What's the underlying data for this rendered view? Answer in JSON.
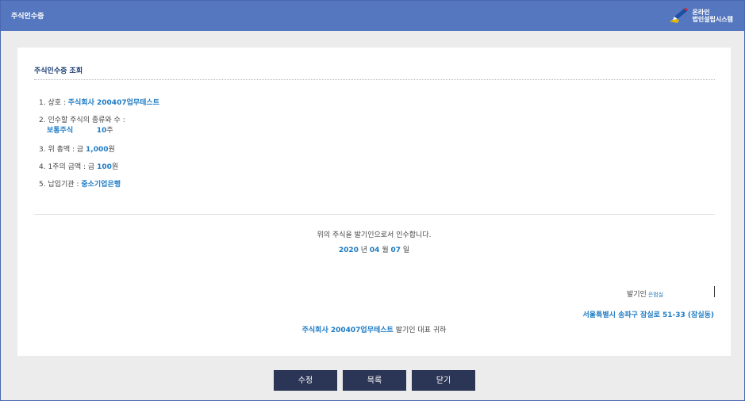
{
  "window": {
    "title": "주식인수증",
    "brand_line1": "온라인",
    "brand_line2": "법인설립시스템"
  },
  "section": {
    "title": "주식인수증 조회"
  },
  "items": {
    "company_label": "1. 상호 : ",
    "company_value": "주식회사 200407업무테스트",
    "stock_label": "2. 인수할 주식의 종류와 수 :",
    "stock_type": "보통주식",
    "stock_count": "10",
    "stock_unit": "주",
    "total_label": "3. 위 총액 : 금 ",
    "total_value": "1,000",
    "total_unit": "원",
    "par_label": "4. 1주의 금액 : 금 ",
    "par_value": "100",
    "par_unit": "원",
    "bank_label": "5. 납입기관 : ",
    "bank_value": "중소기업은행"
  },
  "statement": {
    "text": "위의 주식을 발기인으로서 인수합니다.",
    "year": "2020",
    "year_unit": " 년 ",
    "month": "04",
    "month_unit": " 월 ",
    "day": "07",
    "day_unit": " 일"
  },
  "issuer": {
    "label": "발기인",
    "name": "은범실",
    "address": "서울특별시 송파구 잠실로 51-33 (잠실동)"
  },
  "recipient": {
    "company": "주식회사 200407업무테스트",
    "suffix": " 발기인 대표 귀하"
  },
  "buttons": {
    "edit": "수정",
    "list": "목록",
    "close": "닫기"
  },
  "colors": {
    "titlebar": "#5577bf",
    "accent": "#1e7bc4",
    "button": "#2b3555"
  }
}
